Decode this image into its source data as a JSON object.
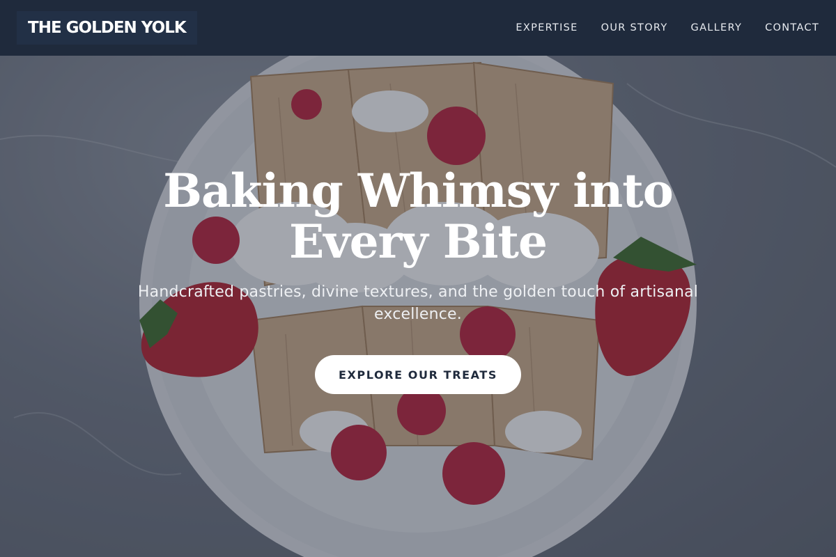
{
  "site": {
    "brand": "THE GOLDEN YOLK"
  },
  "nav": {
    "items": [
      {
        "label": "EXPERTISE"
      },
      {
        "label": "OUR STORY"
      },
      {
        "label": "GALLERY"
      },
      {
        "label": "CONTACT"
      }
    ]
  },
  "hero": {
    "headline": "Baking Whimsy into Every Bite",
    "tagline": "Handcrafted pastries, divine textures, and the golden touch of artisanal excellence.",
    "cta_label": "EXPLORE OUR TREATS",
    "image_subject": "crepes-with-strawberries-raspberries-and-cream"
  },
  "colors": {
    "header_bg": "#1f2a3c",
    "cta_bg": "#ffffff",
    "cta_text": "#1f2a3c",
    "text_light": "#ffffff"
  }
}
